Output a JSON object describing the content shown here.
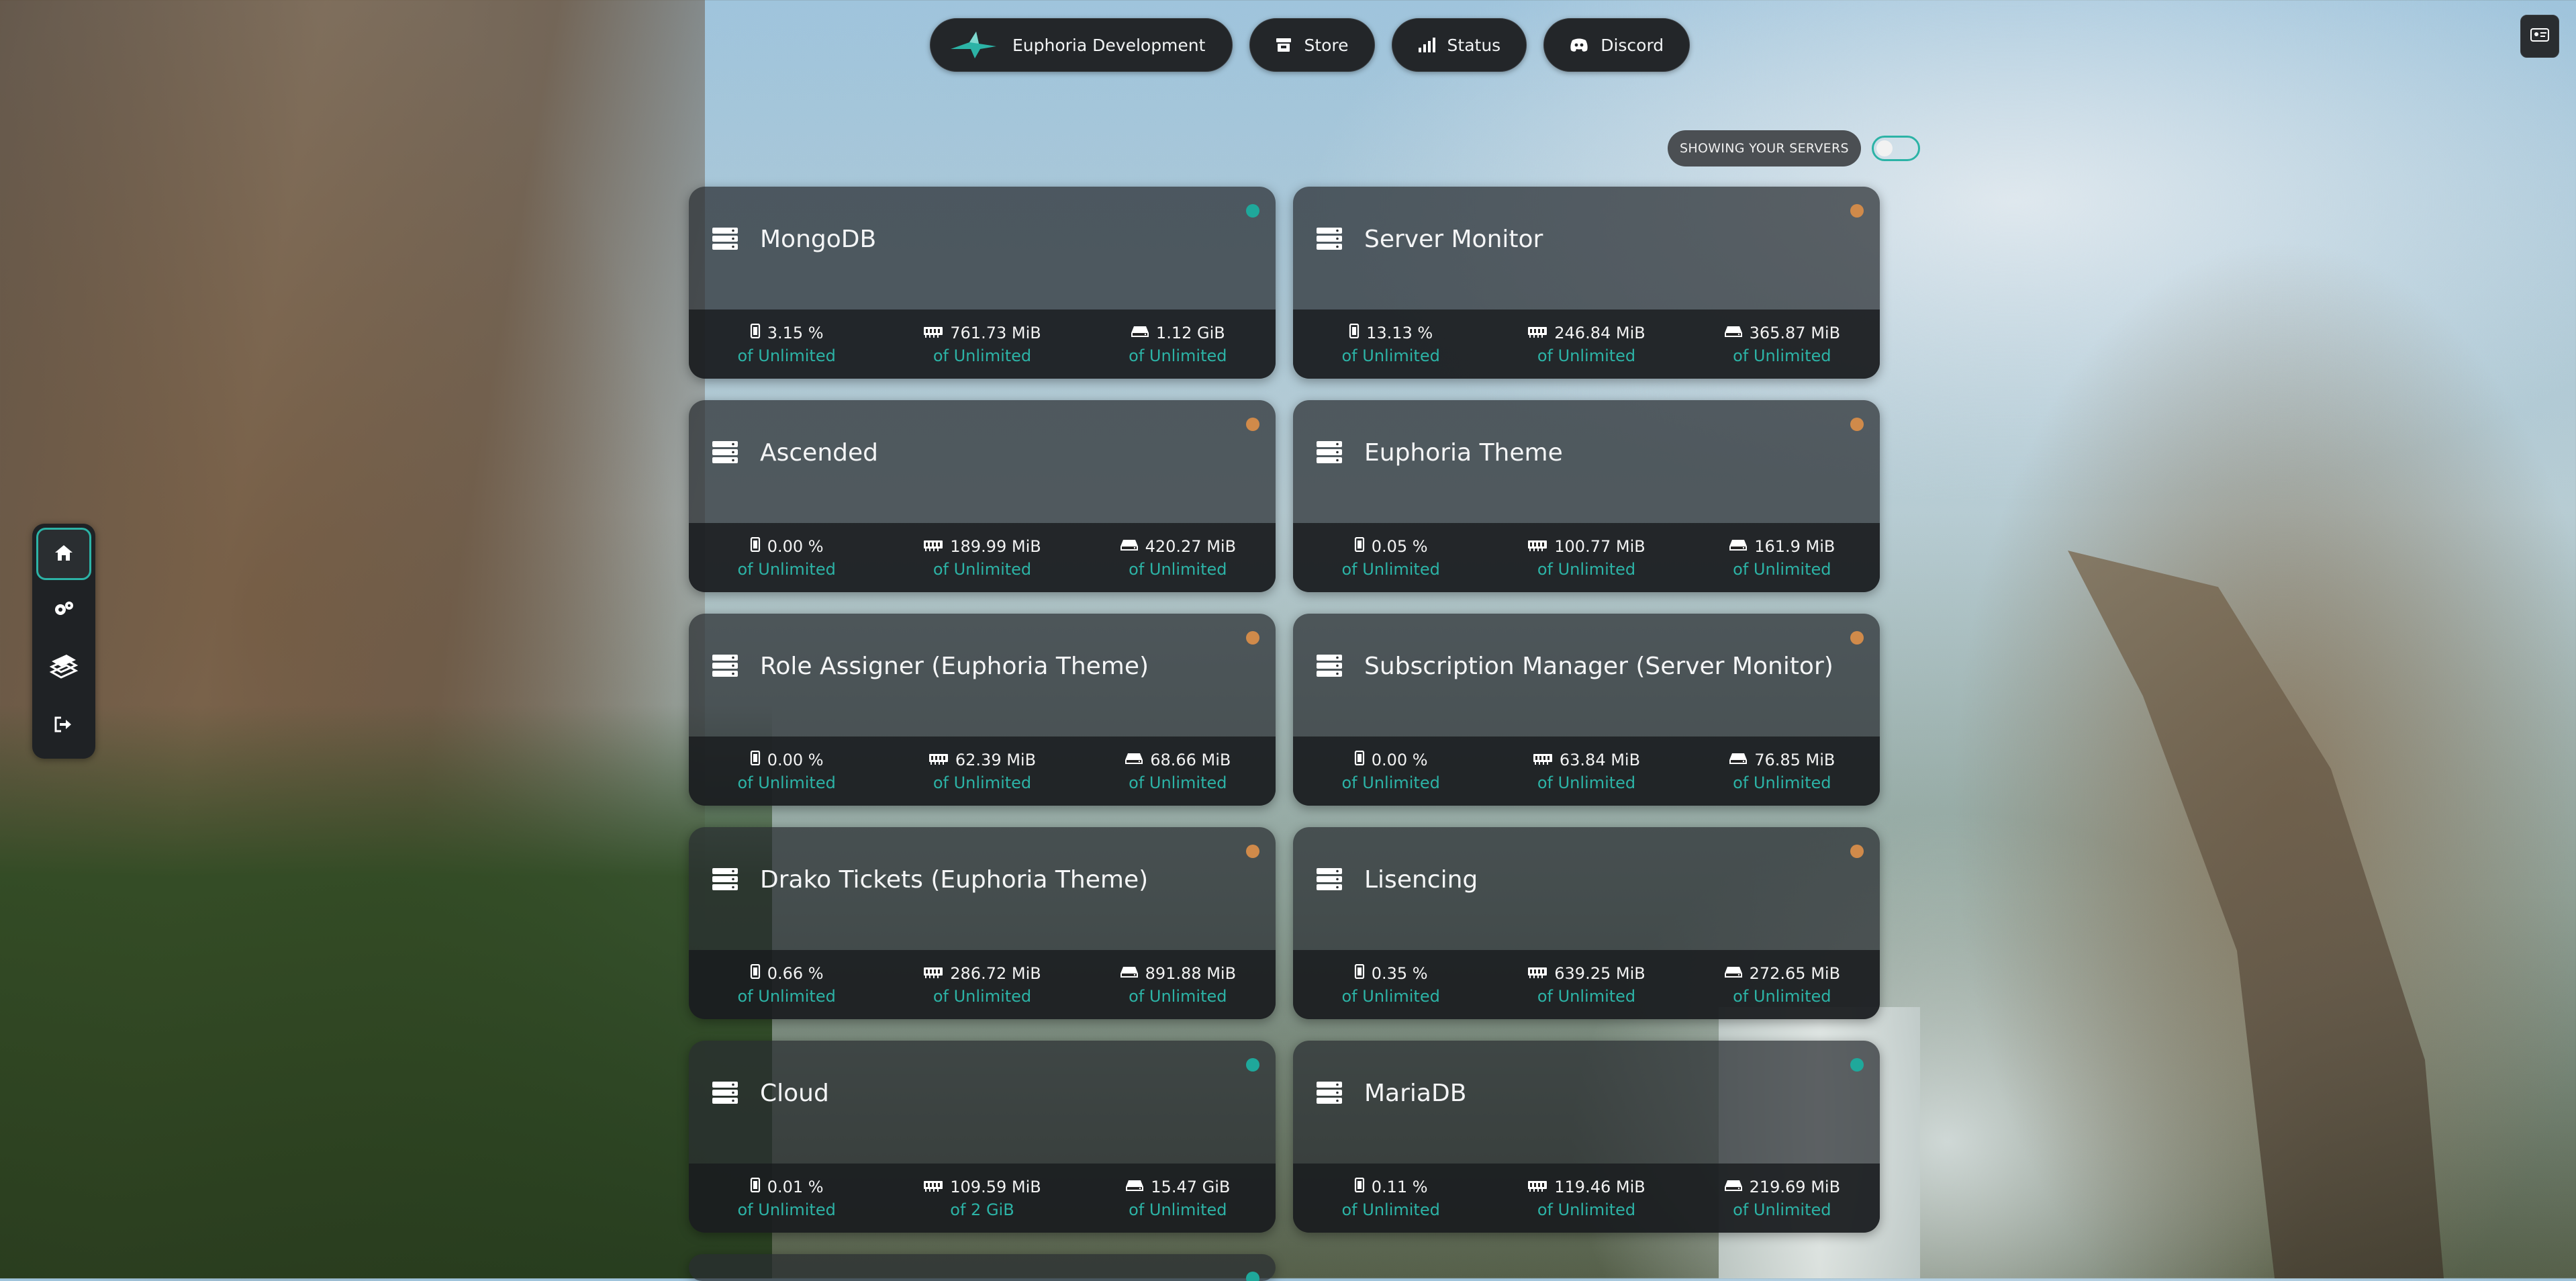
{
  "nav": {
    "brand": {
      "label": "Euphoria Development",
      "icon": "pterodactyl-logo"
    },
    "items": [
      {
        "label": "Store",
        "icon": "store-icon"
      },
      {
        "label": "Status",
        "icon": "signal-bars-icon"
      },
      {
        "label": "Discord",
        "icon": "discord-icon"
      }
    ]
  },
  "filter": {
    "label": "SHOWING YOUR SERVERS",
    "toggle_on": false
  },
  "sidebar": {
    "items": [
      {
        "name": "home",
        "icon": "home-icon",
        "active": true
      },
      {
        "name": "settings",
        "icon": "gears-icon",
        "active": false
      },
      {
        "name": "layers",
        "icon": "layers-icon",
        "active": false
      },
      {
        "name": "logout",
        "icon": "logout-icon",
        "active": false
      }
    ]
  },
  "colors": {
    "accent": "#2cb3a6",
    "online": "#1fa89b",
    "starting": "#d08a4a"
  },
  "servers": [
    {
      "name": "MongoDB",
      "status": "online",
      "cpu": "3.15 %",
      "cpu_limit": "of Unlimited",
      "memory": "761.73 MiB",
      "memory_limit": "of Unlimited",
      "disk": "1.12 GiB",
      "disk_limit": "of Unlimited"
    },
    {
      "name": "Server Monitor",
      "status": "starting",
      "cpu": "13.13 %",
      "cpu_limit": "of Unlimited",
      "memory": "246.84 MiB",
      "memory_limit": "of Unlimited",
      "disk": "365.87 MiB",
      "disk_limit": "of Unlimited"
    },
    {
      "name": "Ascended",
      "status": "starting",
      "cpu": "0.00 %",
      "cpu_limit": "of Unlimited",
      "memory": "189.99 MiB",
      "memory_limit": "of Unlimited",
      "disk": "420.27 MiB",
      "disk_limit": "of Unlimited"
    },
    {
      "name": "Euphoria Theme",
      "status": "starting",
      "cpu": "0.05 %",
      "cpu_limit": "of Unlimited",
      "memory": "100.77 MiB",
      "memory_limit": "of Unlimited",
      "disk": "161.9 MiB",
      "disk_limit": "of Unlimited"
    },
    {
      "name": "Role Assigner (Euphoria Theme)",
      "status": "starting",
      "cpu": "0.00 %",
      "cpu_limit": "of Unlimited",
      "memory": "62.39 MiB",
      "memory_limit": "of Unlimited",
      "disk": "68.66 MiB",
      "disk_limit": "of Unlimited"
    },
    {
      "name": "Subscription Manager (Server Monitor)",
      "status": "starting",
      "cpu": "0.00 %",
      "cpu_limit": "of Unlimited",
      "memory": "63.84 MiB",
      "memory_limit": "of Unlimited",
      "disk": "76.85 MiB",
      "disk_limit": "of Unlimited"
    },
    {
      "name": "Drako Tickets (Euphoria Theme)",
      "status": "starting",
      "cpu": "0.66 %",
      "cpu_limit": "of Unlimited",
      "memory": "286.72 MiB",
      "memory_limit": "of Unlimited",
      "disk": "891.88 MiB",
      "disk_limit": "of Unlimited"
    },
    {
      "name": "Lisencing",
      "status": "starting",
      "cpu": "0.35 %",
      "cpu_limit": "of Unlimited",
      "memory": "639.25 MiB",
      "memory_limit": "of Unlimited",
      "disk": "272.65 MiB",
      "disk_limit": "of Unlimited"
    },
    {
      "name": "Cloud",
      "status": "online",
      "cpu": "0.01 %",
      "cpu_limit": "of Unlimited",
      "memory": "109.59 MiB",
      "memory_limit": "of 2 GiB",
      "disk": "15.47 GiB",
      "disk_limit": "of Unlimited"
    },
    {
      "name": "MariaDB",
      "status": "online",
      "cpu": "0.11 %",
      "cpu_limit": "of Unlimited",
      "memory": "119.46 MiB",
      "memory_limit": "of Unlimited",
      "disk": "219.69 MiB",
      "disk_limit": "of Unlimited"
    }
  ]
}
